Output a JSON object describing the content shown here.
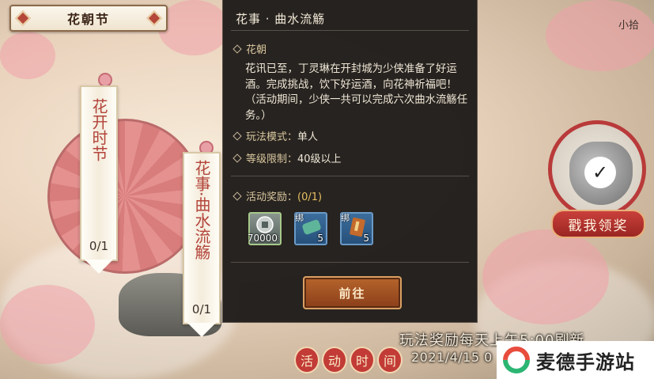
{
  "header": {
    "title": "花朝节"
  },
  "tags": [
    {
      "label": "花开时节",
      "count": "0/1"
    },
    {
      "label": "花事·曲水流觞",
      "count": "0/1"
    }
  ],
  "panel": {
    "title": "花事 · 曲水流觞",
    "section_name": "花朝",
    "description": "花讯已至，丁灵琳在开封城为少侠准备了好运酒。完成挑战，饮下好运酒，向花神祈福吧！（活动期间，少侠一共可以完成六次曲水流觞任务。）",
    "mode_label": "玩法模式：",
    "mode_value": "单人",
    "level_label": "等级限制：",
    "level_value": "40级以上",
    "rewards_label": "活动奖励：",
    "rewards_progress": "(0/1)",
    "rewards": [
      {
        "icon": "coin-icon",
        "bound": "",
        "qty": "70000"
      },
      {
        "icon": "jade-icon",
        "bound": "绑",
        "qty": "5"
      },
      {
        "icon": "book-icon",
        "bound": "绑",
        "qty": "5"
      }
    ],
    "go_button": "前往"
  },
  "claim": {
    "button": "戳我领奖"
  },
  "top_right_text": "小拾",
  "bottom": {
    "reward_note": "玩法奖励每天上午5:00刷新",
    "event_time_chars": [
      "活",
      "动",
      "时",
      "间"
    ],
    "event_date": "2021/4/15 0"
  },
  "watermark": {
    "text": "麦德手游站"
  },
  "colors": {
    "accent_red": "#c23b36",
    "gold": "#e6c062",
    "panel_bg": "#1e1b19"
  }
}
